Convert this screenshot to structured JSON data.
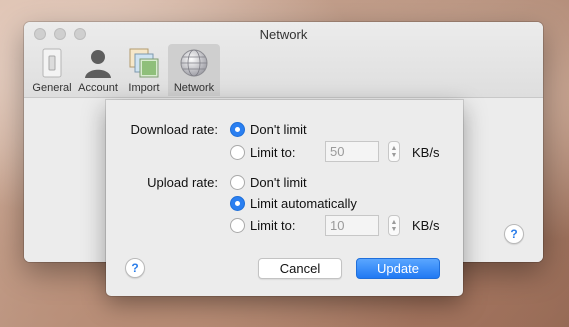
{
  "window": {
    "title": "Network"
  },
  "toolbar": {
    "tabs": [
      {
        "label": "General",
        "icon": "switch-icon"
      },
      {
        "label": "Account",
        "icon": "person-icon"
      },
      {
        "label": "Import",
        "icon": "photos-icon"
      },
      {
        "label": "Network",
        "icon": "globe-icon"
      }
    ],
    "active_tab": "Network"
  },
  "help_label": "?",
  "sheet": {
    "download": {
      "label": "Download rate:",
      "option_dont_limit": "Don't limit",
      "option_limit_to": "Limit to:",
      "selected": "Don't limit",
      "value": "50",
      "unit": "KB/s"
    },
    "upload": {
      "label": "Upload rate:",
      "option_dont_limit": "Don't limit",
      "option_limit_auto": "Limit automatically",
      "option_limit_to": "Limit to:",
      "selected": "Limit automatically",
      "value": "10",
      "unit": "KB/s"
    },
    "buttons": {
      "cancel": "Cancel",
      "update": "Update"
    }
  },
  "colors": {
    "accent": "#2a7ff1",
    "window_bg": "#ececec"
  }
}
